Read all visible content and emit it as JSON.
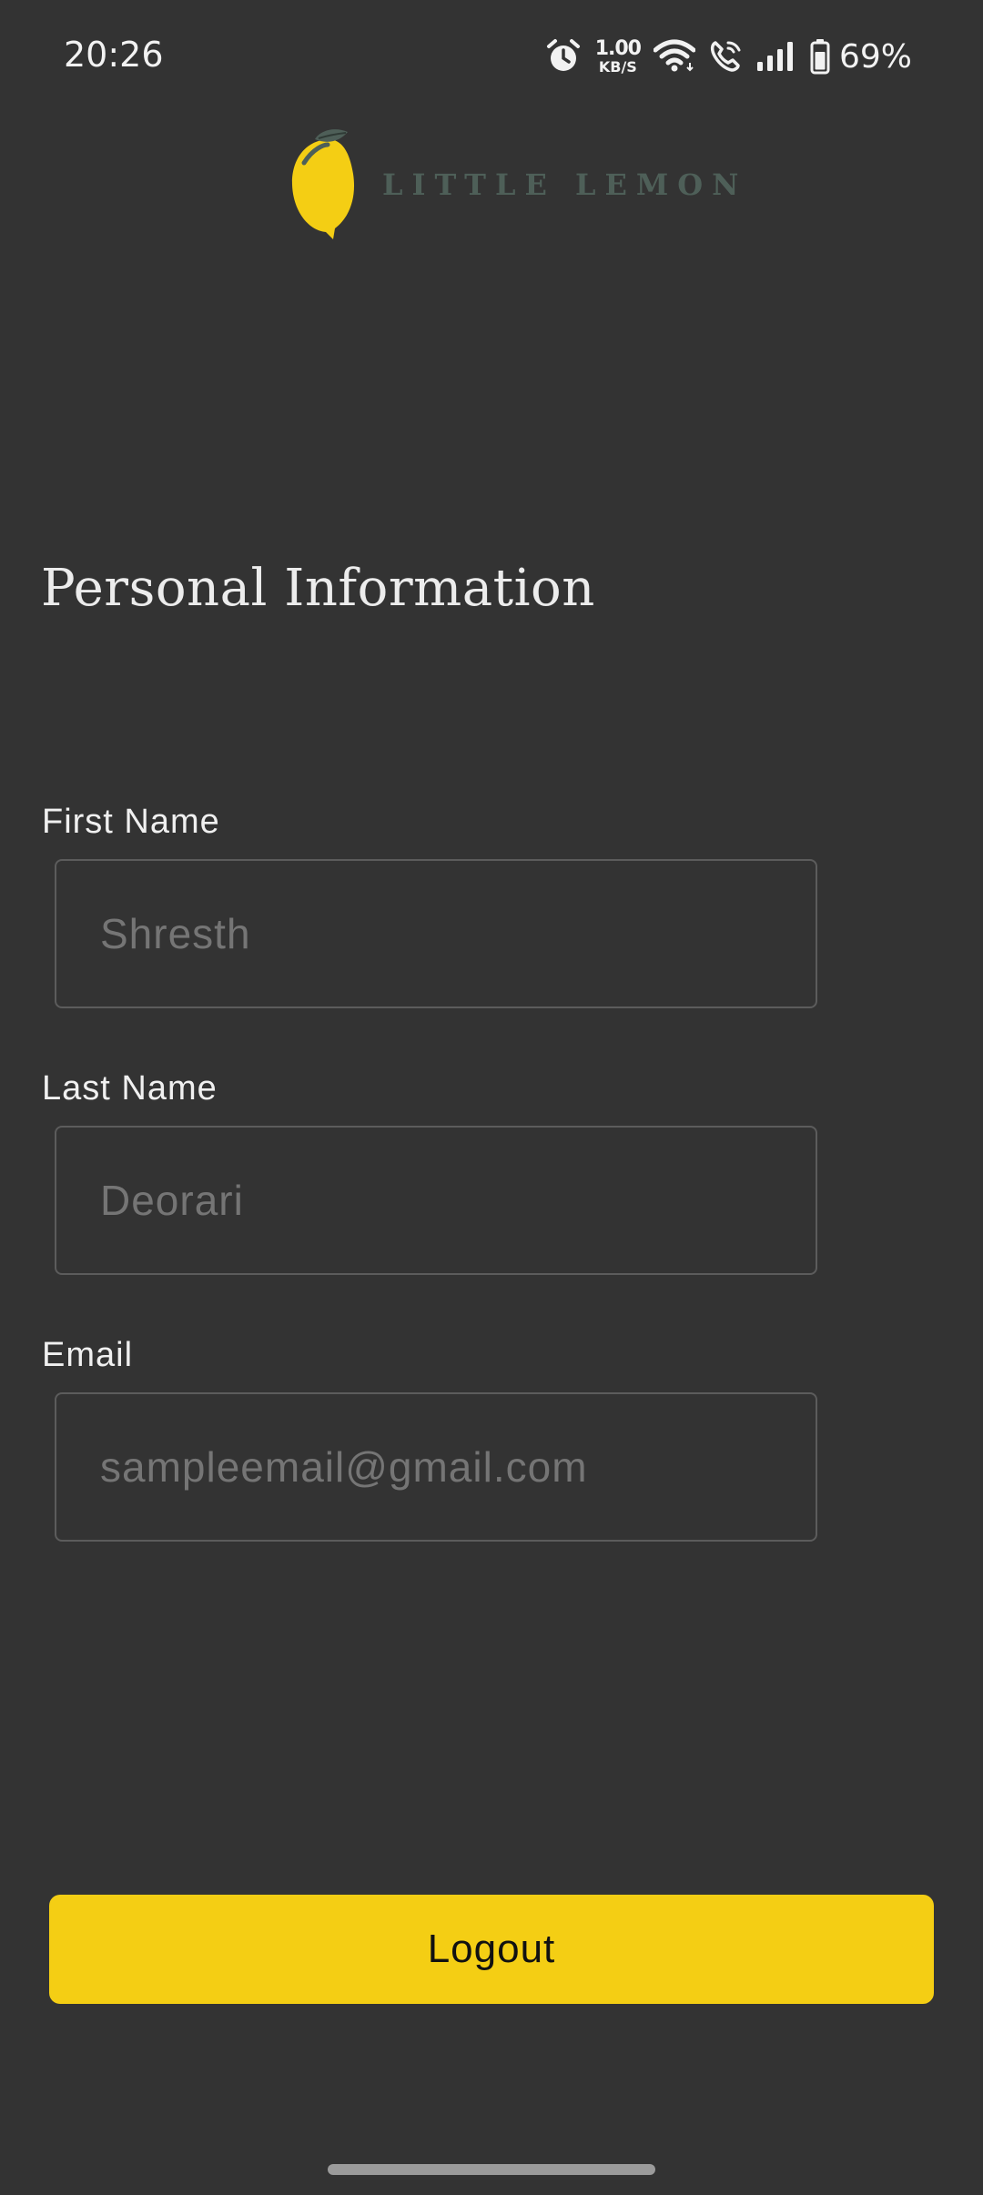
{
  "status_bar": {
    "time": "20:26",
    "net_speed_value": "1.00",
    "net_speed_unit": "KB/S",
    "battery_percent": "69%",
    "icons": [
      "alarm-icon",
      "wifi-icon",
      "call-icon",
      "signal-icon",
      "battery-icon"
    ]
  },
  "logo": {
    "text": "LITTLE LEMON",
    "icon": "lemon-icon",
    "lemon_color": "#F4CE14",
    "text_color": "#4E5F58"
  },
  "page": {
    "title": "Personal Information"
  },
  "form": {
    "first_name": {
      "label": "First Name",
      "placeholder": "Shresth"
    },
    "last_name": {
      "label": "Last Name",
      "placeholder": "Deorari"
    },
    "email": {
      "label": "Email",
      "placeholder": "sampleemail@gmail.com"
    }
  },
  "actions": {
    "logout_label": "Logout"
  },
  "colors": {
    "background": "#333333",
    "accent": "#F4CE14",
    "input_border": "#5C5C5C",
    "placeholder": "#9A9A9A"
  }
}
